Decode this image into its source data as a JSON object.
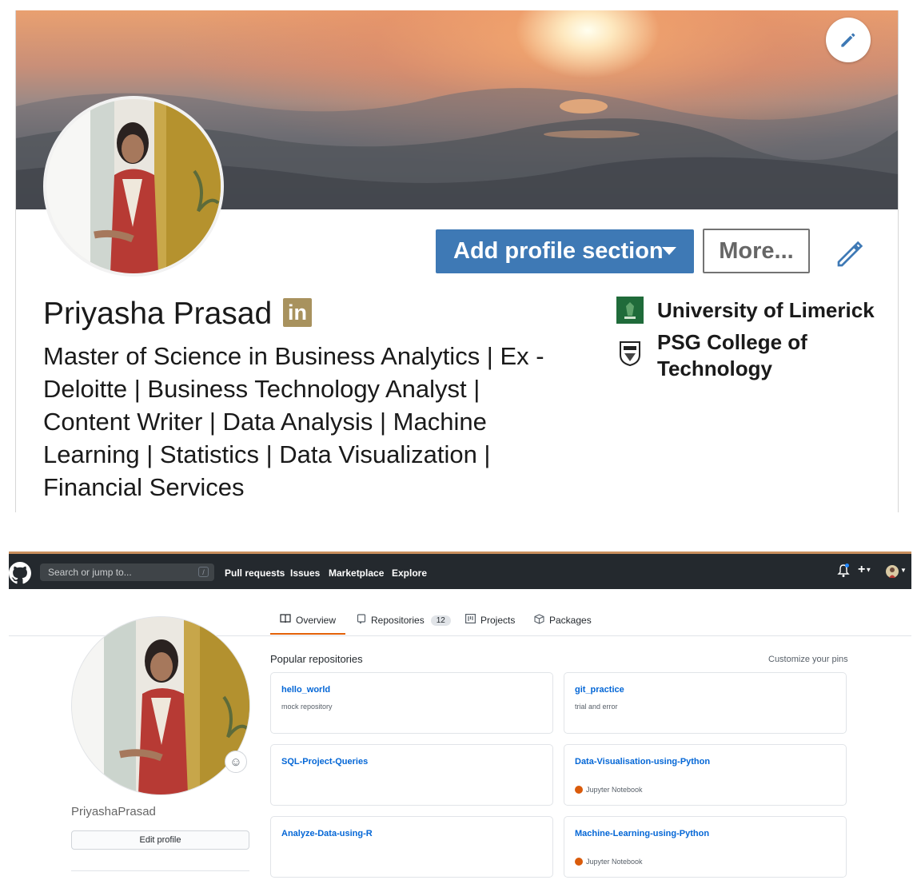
{
  "linkedin": {
    "add_section_label": "Add profile section",
    "more_label": "More...",
    "name": "Priyasha Prasad",
    "badge_text": "in",
    "headline": "Master of Science in Business Analytics | Ex - Deloitte | Business Technology Analyst | Content Writer | Data Analysis | Machine Learning | Statistics | Data Visualization | Financial Services",
    "education": [
      {
        "name": "University of Limerick",
        "logo": "university-limerick-logo"
      },
      {
        "name_line1": "PSG College of",
        "name_line2": "Technology",
        "logo": "psg-college-logo"
      }
    ],
    "accent": "#3e79b5"
  },
  "github": {
    "search_placeholder": "Search or jump to...",
    "search_shortcut": "/",
    "nav": [
      "Pull requests",
      "Issues",
      "Marketplace",
      "Explore"
    ],
    "tabs": [
      {
        "label": "Overview",
        "icon": "book-icon"
      },
      {
        "label": "Repositories",
        "icon": "repo-icon",
        "count": "12"
      },
      {
        "label": "Projects",
        "icon": "project-icon"
      },
      {
        "label": "Packages",
        "icon": "package-icon"
      }
    ],
    "username": "PriyashaPrasad",
    "edit_profile_label": "Edit profile",
    "popular_title": "Popular repositories",
    "customize_label": "Customize your pins",
    "repos": [
      {
        "name": "hello_world",
        "description": "mock repository"
      },
      {
        "name": "git_practice",
        "description": "trial and error"
      },
      {
        "name": "SQL-Project-Queries"
      },
      {
        "name": "Data-Visualisation-using-Python",
        "language": "Jupyter Notebook",
        "lang_color": "#DA5B0B"
      },
      {
        "name": "Analyze-Data-using-R"
      },
      {
        "name": "Machine-Learning-using-Python",
        "language": "Jupyter Notebook",
        "lang_color": "#DA5B0B"
      }
    ],
    "header_bg": "#24292e",
    "active_tab_color": "#e36209",
    "link_color": "#0366d6"
  }
}
